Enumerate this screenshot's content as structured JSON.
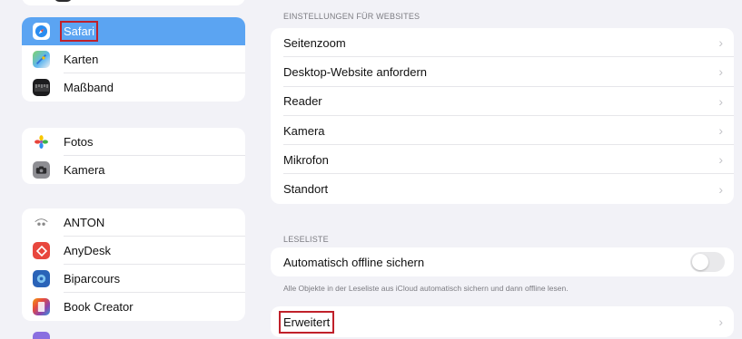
{
  "sidebar": {
    "group1": [
      {
        "label": "Safari",
        "icon": "safari-icon",
        "selected": true
      },
      {
        "label": "Karten",
        "icon": "maps-icon"
      },
      {
        "label": "Maßband",
        "icon": "measure-icon"
      }
    ],
    "group2": [
      {
        "label": "Fotos",
        "icon": "photos-icon"
      },
      {
        "label": "Kamera",
        "icon": "camera-icon"
      }
    ],
    "group3": [
      {
        "label": "ANTON",
        "icon": "anton-icon"
      },
      {
        "label": "AnyDesk",
        "icon": "anydesk-icon"
      },
      {
        "label": "Biparcours",
        "icon": "biparcours-icon"
      },
      {
        "label": "Book Creator",
        "icon": "book-creator-icon"
      }
    ]
  },
  "main": {
    "websites_header": "EINSTELLUNGEN FÜR WEBSITES",
    "websites": [
      {
        "label": "Seitenzoom"
      },
      {
        "label": "Desktop-Website anfordern"
      },
      {
        "label": "Reader"
      },
      {
        "label": "Kamera"
      },
      {
        "label": "Mikrofon"
      },
      {
        "label": "Standort"
      }
    ],
    "reading_header": "LESELISTE",
    "offline_label": "Automatisch offline sichern",
    "offline_toggle_on": false,
    "offline_note": "Alle Objekte in der Leseliste aus iCloud automatisch sichern und dann offline lesen.",
    "advanced_label": "Erweitert",
    "chevron": "›"
  },
  "colors": {
    "selected_row": "#5ba4f2",
    "highlight": "#c0202a",
    "background": "#f2f2f7"
  }
}
